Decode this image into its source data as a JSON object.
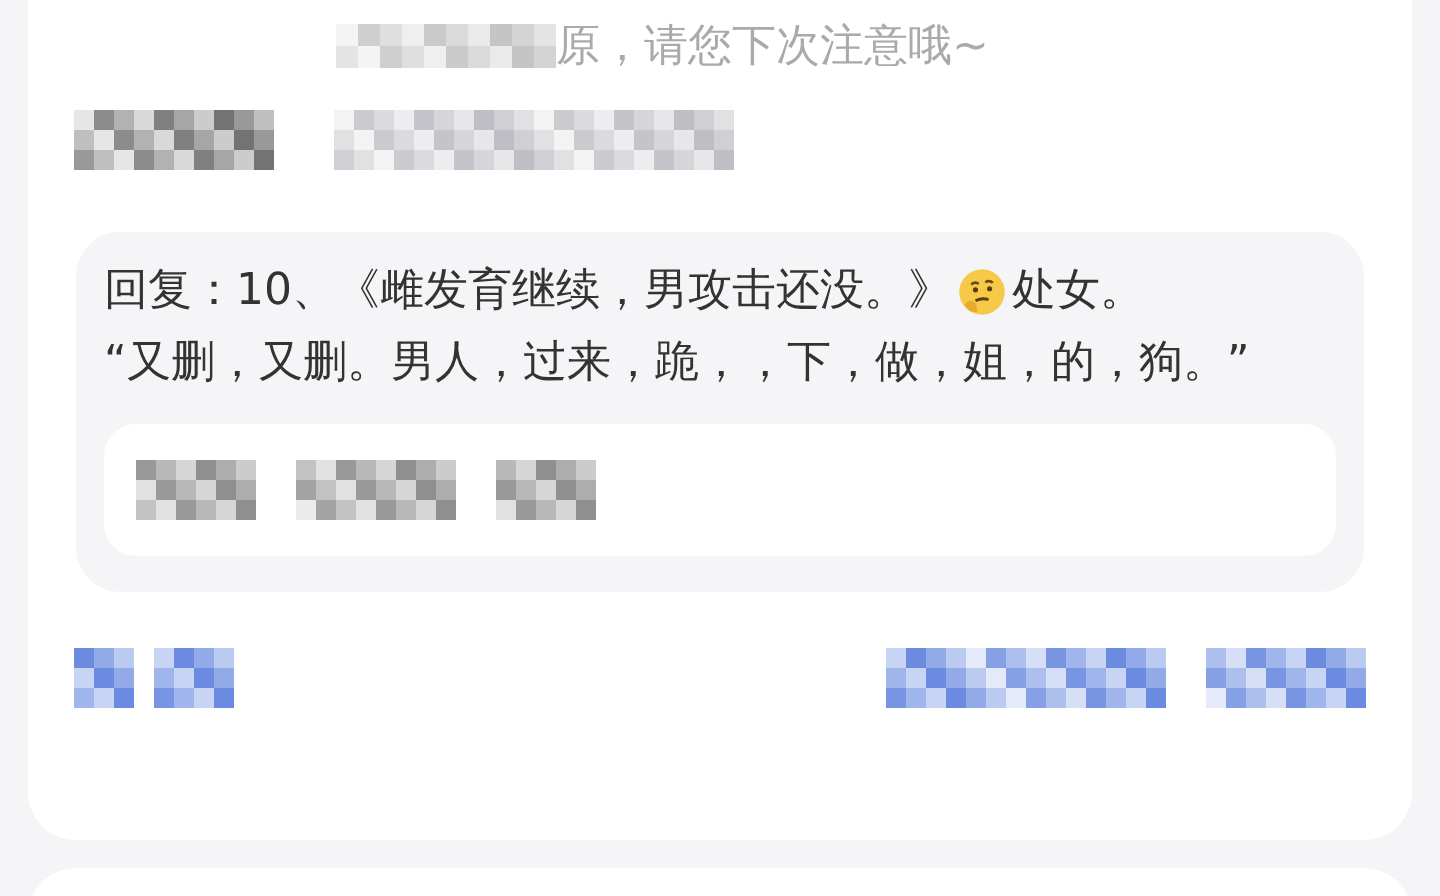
{
  "notice": {
    "text": "原，请您下次注意哦~"
  },
  "reply": {
    "text_before": "回复：10、《雌发育继续，男攻击还没。》",
    "text_after": "处女。",
    "continuation": "“又删，又删。男人，过来，跪，，下，做，姐，的，狗。”"
  }
}
